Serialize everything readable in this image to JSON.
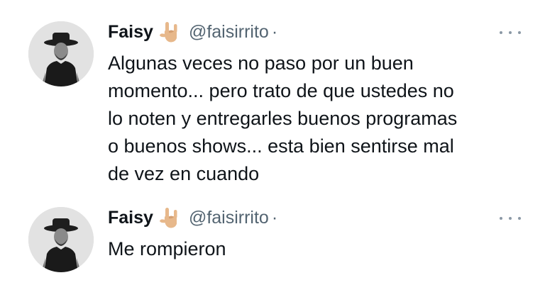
{
  "tweets": [
    {
      "author": {
        "name": "Faisy",
        "name_emoji": "sign-of-the-horns-emoji",
        "handle": "@faisirrito",
        "separator": "·"
      },
      "text": "Algunas veces no paso por un buen\nmomento... pero trato de que ustedes no\nlo noten y entregarles buenos programas\no buenos shows... esta bien sentirse mal\nde vez en cuando",
      "more_icon": "more-options-icon"
    },
    {
      "author": {
        "name": "Faisy",
        "name_emoji": "sign-of-the-horns-emoji",
        "handle": "@faisirrito",
        "separator": "·"
      },
      "text": "Me rompieron",
      "more_icon": "more-options-icon"
    }
  ],
  "colors": {
    "text_primary": "#0f1419",
    "text_secondary": "#536471",
    "background": "#ffffff"
  }
}
